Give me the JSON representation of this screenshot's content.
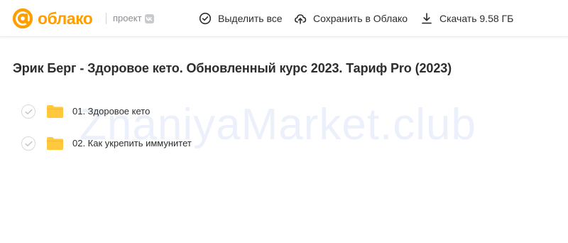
{
  "header": {
    "logo_text": "облако",
    "project_label": "проект",
    "vk_badge": "vk-logo-icon",
    "actions": {
      "select_all": "Выделить все",
      "save_to_cloud": "Сохранить в Облако",
      "download": "Скачать 9.58 ГБ"
    }
  },
  "main": {
    "title": "Эрик Берг - Здоровое кето. Обновленный курс 2023. Тариф Pro (2023)",
    "items": [
      {
        "name": "01. Здоровое кето",
        "type": "folder"
      },
      {
        "name": "02. Как укрепить иммунитет",
        "type": "folder"
      }
    ]
  },
  "watermark": "ZnaniyaMarket.club",
  "colors": {
    "brand_orange": "#ff9e00",
    "folder_yellow": "#ffc83d",
    "text_primary": "#2c2d2e",
    "text_secondary": "#8a8d91"
  }
}
